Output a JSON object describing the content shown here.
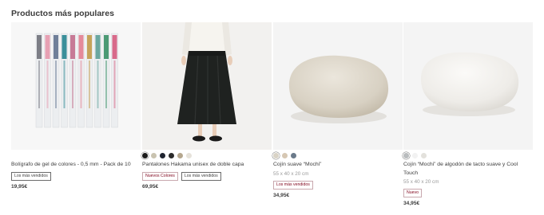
{
  "section": {
    "title": "Productos más populares"
  },
  "colors": {
    "text": "#3c3c3c",
    "muted": "#9a9a9a",
    "accent_red": "#7f0019",
    "image_bg": "#f3f3f3"
  },
  "products": [
    {
      "name": "Bolígrafo de gel de colores - 0,5 mm - Pack de 10",
      "dimensions": "",
      "badges": [
        "Los más vendidos"
      ],
      "price": "19,95€",
      "swatches": [],
      "image_icon": "gel-pens-pack-image"
    },
    {
      "name": "Pantalones Hakama unisex de doble capa",
      "dimensions": "",
      "badges": [
        "Nuevos Colores",
        "Los más vendidos"
      ],
      "price": "69,95€",
      "swatches": [
        "#1c1c1c",
        "#c9c3b0",
        "#1f2430",
        "#2b2b2b",
        "#b5a78e",
        "#e6e2da"
      ],
      "image_icon": "hakama-pants-image"
    },
    {
      "name": "Cojín suave “Mochi”",
      "dimensions": "55 x 40 x 20 cm",
      "badges": [
        "Los más vendidos"
      ],
      "price": "34,95€",
      "swatches": [
        "#d9d3c6",
        "#d6c7b3",
        "#6b7a8a"
      ],
      "image_icon": "mochi-cushion-beige-image"
    },
    {
      "name": "Cojín “Mochi” de algodón de tacto suave y Cool Touch",
      "dimensions": "55 x 40 x 20 cm",
      "badges": [
        "Nuevo"
      ],
      "price": "34,95€",
      "swatches": [
        "#b9bcbe",
        "#f2f2f2",
        "#e3e1dc"
      ],
      "image_icon": "mochi-cushion-white-image"
    }
  ]
}
